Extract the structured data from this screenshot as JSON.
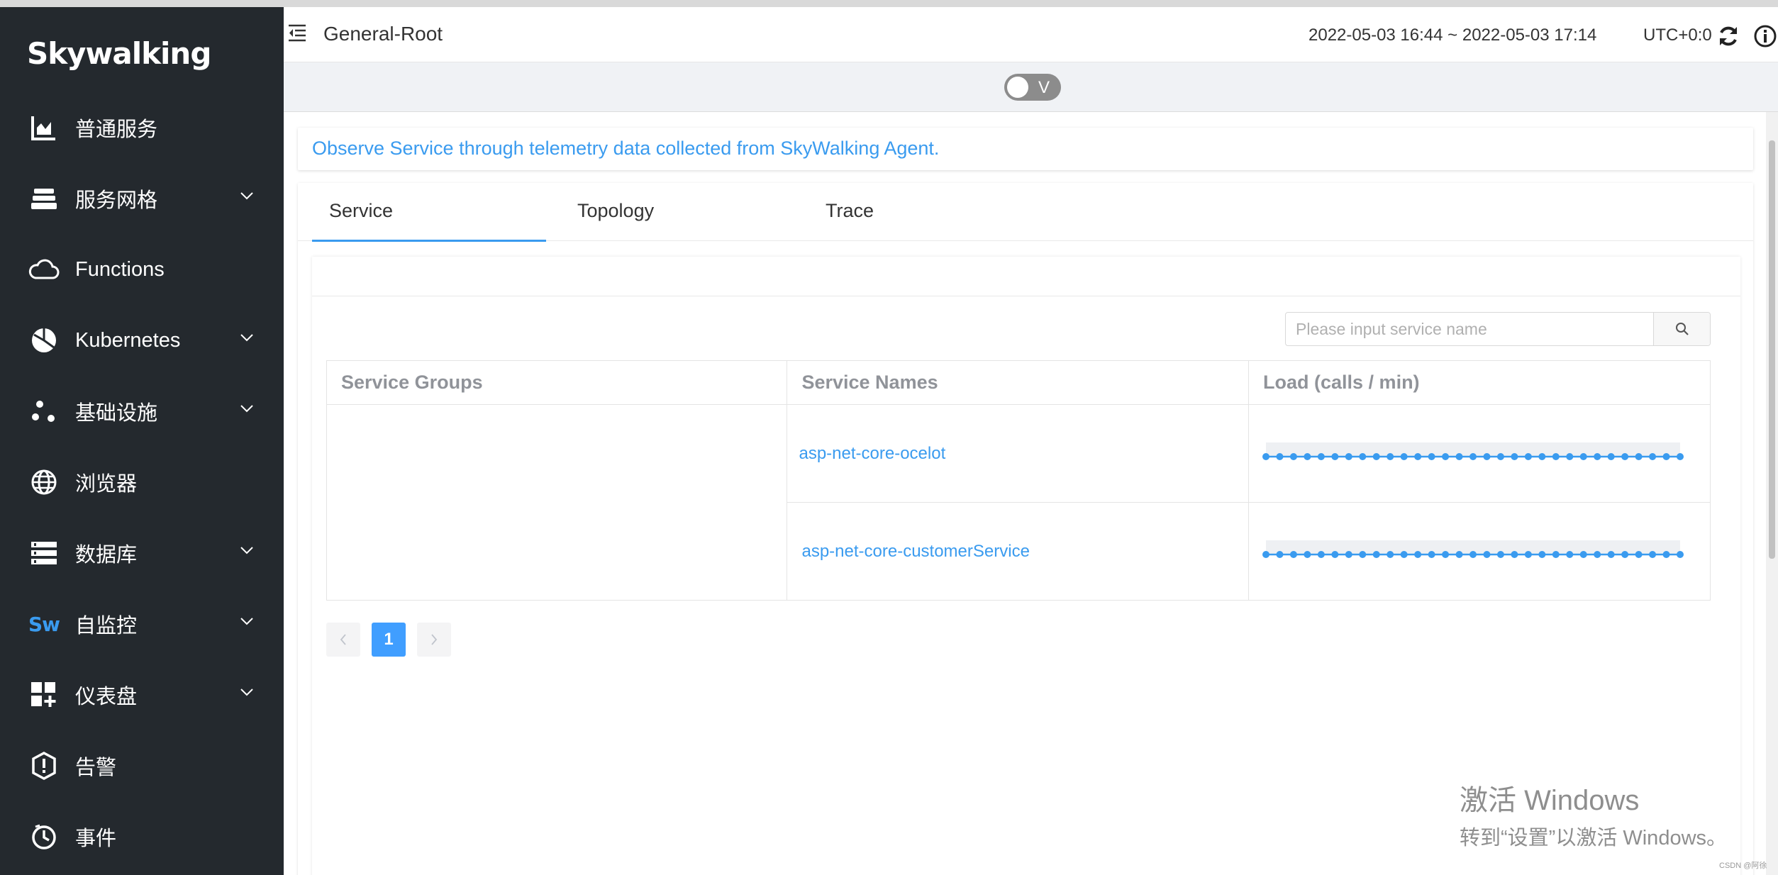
{
  "app": {
    "logo": "Skywalking"
  },
  "sidebar": {
    "items": [
      {
        "label": "普通服务",
        "icon": "chart-icon",
        "has_submenu": false
      },
      {
        "label": "服务网格",
        "icon": "mesh-icon",
        "has_submenu": true
      },
      {
        "label": "Functions",
        "icon": "cloud-icon",
        "has_submenu": false
      },
      {
        "label": "Kubernetes",
        "icon": "kubernetes-icon",
        "has_submenu": true
      },
      {
        "label": "基础设施",
        "icon": "infrastructure-icon",
        "has_submenu": true
      },
      {
        "label": "浏览器",
        "icon": "globe-icon",
        "has_submenu": false
      },
      {
        "label": "数据库",
        "icon": "database-icon",
        "has_submenu": true
      },
      {
        "label": "自监控",
        "icon": "sw-icon",
        "has_submenu": true
      },
      {
        "label": "仪表盘",
        "icon": "dashboard-icon",
        "has_submenu": true
      },
      {
        "label": "告警",
        "icon": "alarm-icon",
        "has_submenu": false
      },
      {
        "label": "事件",
        "icon": "event-icon",
        "has_submenu": false
      }
    ],
    "sw_icon_text": "Sw"
  },
  "header": {
    "title": "General-Root",
    "time_range": "2022-05-03 16:44 ~ 2022-05-03 17:14",
    "timezone": "UTC+0:0"
  },
  "toolbar": {
    "toggle_label": "V",
    "toggle_on": false
  },
  "main": {
    "description": "Observe Service through telemetry data collected from SkyWalking Agent.",
    "tabs": [
      {
        "label": "Service",
        "active": true
      },
      {
        "label": "Topology",
        "active": false
      },
      {
        "label": "Trace",
        "active": false
      }
    ],
    "search": {
      "placeholder": "Please input service name",
      "value": ""
    },
    "table": {
      "headers": [
        "Service Groups",
        "Service Names",
        "Load (calls / min)"
      ],
      "rows": [
        {
          "group": "",
          "name": "asp-net-core-ocelot",
          "load_points": 31
        },
        {
          "group": "",
          "name": "asp-net-core-customerService",
          "load_points": 31
        }
      ]
    },
    "pagination": {
      "current": "1"
    }
  },
  "colors": {
    "sidebar_bg": "#24292e",
    "accent": "#3a9bef",
    "pager_active": "#409eff"
  },
  "watermark": {
    "line1": "激活 Windows",
    "line2": "转到“设置”以激活 Windows。",
    "source": "CSDN @阿徐"
  }
}
